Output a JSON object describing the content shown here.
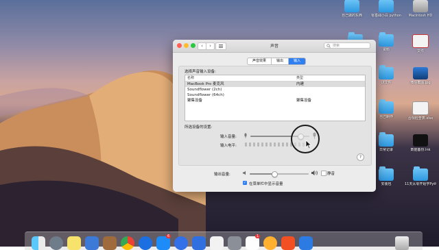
{
  "window": {
    "title": "声音",
    "search_placeholder": "搜索",
    "tabs": [
      {
        "label": "声音效果",
        "active": false
      },
      {
        "label": "输出",
        "active": false
      },
      {
        "label": "输入",
        "active": true
      }
    ],
    "device_heading": "选择声音输入设备:",
    "columns": [
      "名称",
      "类型"
    ],
    "devices": [
      {
        "name": "MacBook Pro 麦克风",
        "type": "内建",
        "selected": true
      },
      {
        "name": "Soundflower (2ch)",
        "type": ""
      },
      {
        "name": "Soundflower (64ch)",
        "type": ""
      },
      {
        "name": "聚集设备",
        "type": "聚集设备"
      }
    ],
    "settings_heading": "所选设备的设置:",
    "input_volume_label": "输入音量:",
    "input_level_label": "输入电平:",
    "input_volume": 0.85,
    "output_volume_label": "输出音量:",
    "output_volume": 0.42,
    "mute_label": "静音",
    "show_in_menubar_label": "在菜单栏中显示音量",
    "show_in_menubar_checked": true,
    "help_label": "?"
  },
  "desktop": {
    "icons": [
      {
        "label": "Macintosh HD",
        "kind": "drive"
      },
      {
        "label": "自己做的东西",
        "kind": "folder"
      },
      {
        "label": "零基础小白 python",
        "kind": "folder"
      },
      {
        "label": "",
        "kind": "folder"
      },
      {
        "label": "资料",
        "kind": "folder"
      },
      {
        "label": "文件",
        "kind": "file"
      },
      {
        "label": "UI文件",
        "kind": "folder"
      },
      {
        "label": "微信截图.jpg",
        "kind": "image"
      },
      {
        "label": "自己制作",
        "kind": "folder"
      },
      {
        "label": "合规检查表.xlsx",
        "kind": "file"
      },
      {
        "label": "日常记录",
        "kind": "folder"
      },
      {
        "label": "数据备份.lnk",
        "kind": "app"
      },
      {
        "label": "安装包",
        "kind": "folder"
      },
      {
        "label": "11天从零开始学Python/资料",
        "kind": "folder"
      }
    ]
  },
  "dock": {
    "badges": {
      "appstore": "6",
      "calendar": "1"
    },
    "icons": [
      "finder-icon",
      "launchpad-icon",
      "notes-icon",
      "preview-icon",
      "photo-icon",
      "chrome-icon",
      "safari-icon",
      "appstore-icon",
      "baidu-icon",
      "xunlei-icon",
      "wechat-work-icon",
      "sysprefs-icon",
      "calendar-icon",
      "app-icon",
      "office-icon",
      "finder2-icon",
      "trash-icon"
    ]
  }
}
